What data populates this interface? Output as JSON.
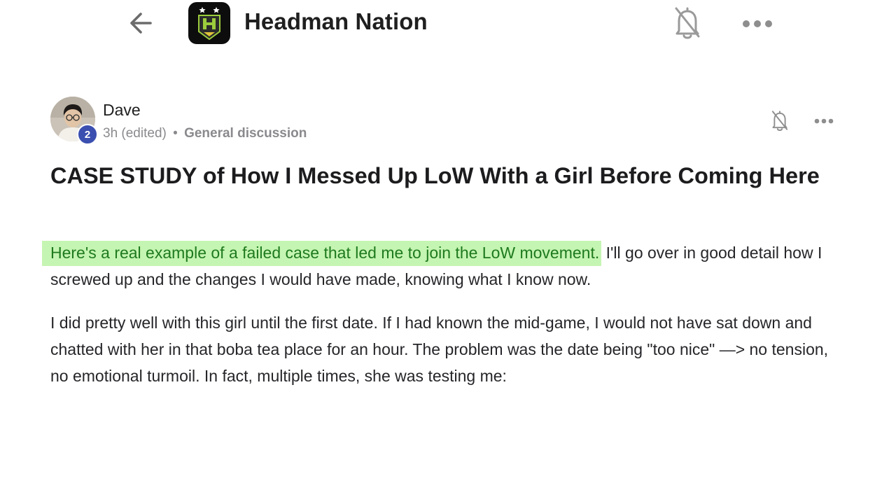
{
  "app": {
    "title": "Headman Nation"
  },
  "topbar": {
    "back_icon": "arrow-left-icon",
    "logo_icon": "headman-shield-logo",
    "bell_icon": "bell-off-icon",
    "more_icon": "more-horizontal-icon"
  },
  "post": {
    "author": "Dave",
    "level": "2",
    "time": "3h (edited)",
    "separator": "•",
    "category": "General discussion",
    "title": "CASE STUDY of How I Messed Up LoW With a Girl Before Coming Here",
    "paragraph1_highlight": "Here's a real example of a failed case that led me to join the LoW movement.",
    "paragraph1_rest": " I'll go over in good detail how I screwed up and the changes I would have made, knowing what I know now.",
    "paragraph2": "I did pretty well with this girl until the first date. If I had known the mid-game, I would not have sat down and chatted with her in that boba tea place for an hour. The problem was the date being \"too nice\" —> no tension, no emotional turmoil. In fact, multiple times, she was testing me:"
  },
  "colors": {
    "highlight_bg": "#c5f5b2",
    "highlight_text": "#1e7a1e",
    "badge": "#3b4fb0",
    "logo_green": "#9ccc3c",
    "logo_yellow": "#e0c33a"
  }
}
